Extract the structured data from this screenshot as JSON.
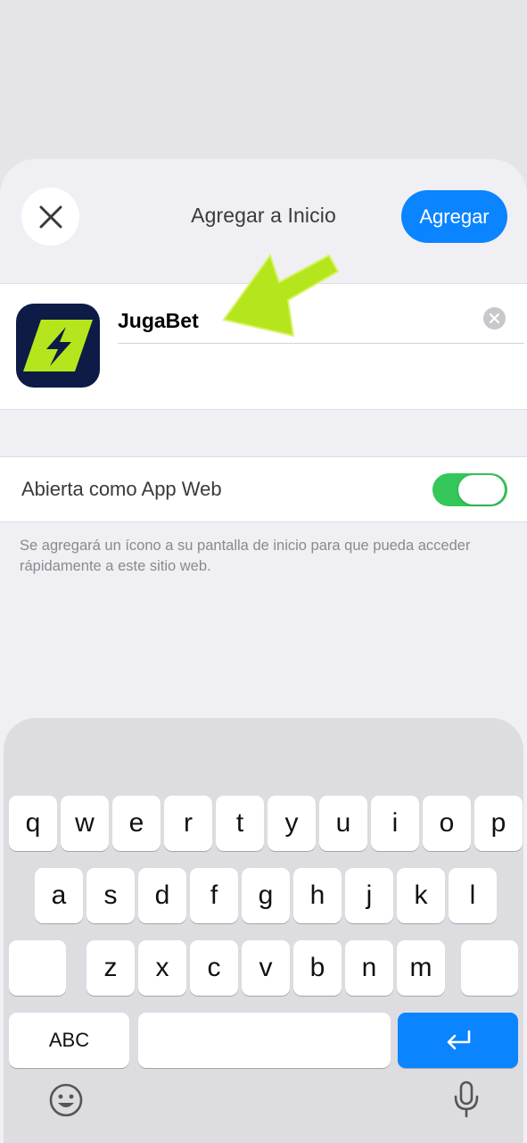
{
  "nav": {
    "title": "Agregar a Inicio",
    "add_label": "Agregar",
    "close_icon": "close-icon"
  },
  "app": {
    "name": "JugaBet",
    "icon": "bolt-icon",
    "icon_colors": {
      "background": "#0d1b46",
      "accent": "#b5e61d"
    },
    "clear_icon": "clear-icon"
  },
  "settings": {
    "web_app_label": "Abierta como App Web",
    "web_app_enabled": true
  },
  "footnote": "Se agregará un ícono a su pantalla de inicio para que pueda acceder rápidamente a este sitio web.",
  "annotation": {
    "icon": "arrow-icon",
    "color": "#b5e61d"
  },
  "keyboard": {
    "row1": [
      "q",
      "w",
      "e",
      "r",
      "t",
      "y",
      "u",
      "i",
      "o",
      "p"
    ],
    "row2": [
      "a",
      "s",
      "d",
      "f",
      "g",
      "h",
      "j",
      "k",
      "l"
    ],
    "row3": [
      "z",
      "x",
      "c",
      "v",
      "b",
      "n",
      "m"
    ],
    "abc_label": "ABC",
    "shift_icon": "shift-key",
    "delete_icon": "delete-key",
    "return_icon": "return-icon",
    "emoji_icon": "emoji-icon",
    "mic_icon": "microphone-icon"
  },
  "colors": {
    "accent_blue": "#0a84ff",
    "toggle_green": "#34c759",
    "sheet_bg": "#efeff4",
    "keyboard_bg": "#dcdce1"
  }
}
